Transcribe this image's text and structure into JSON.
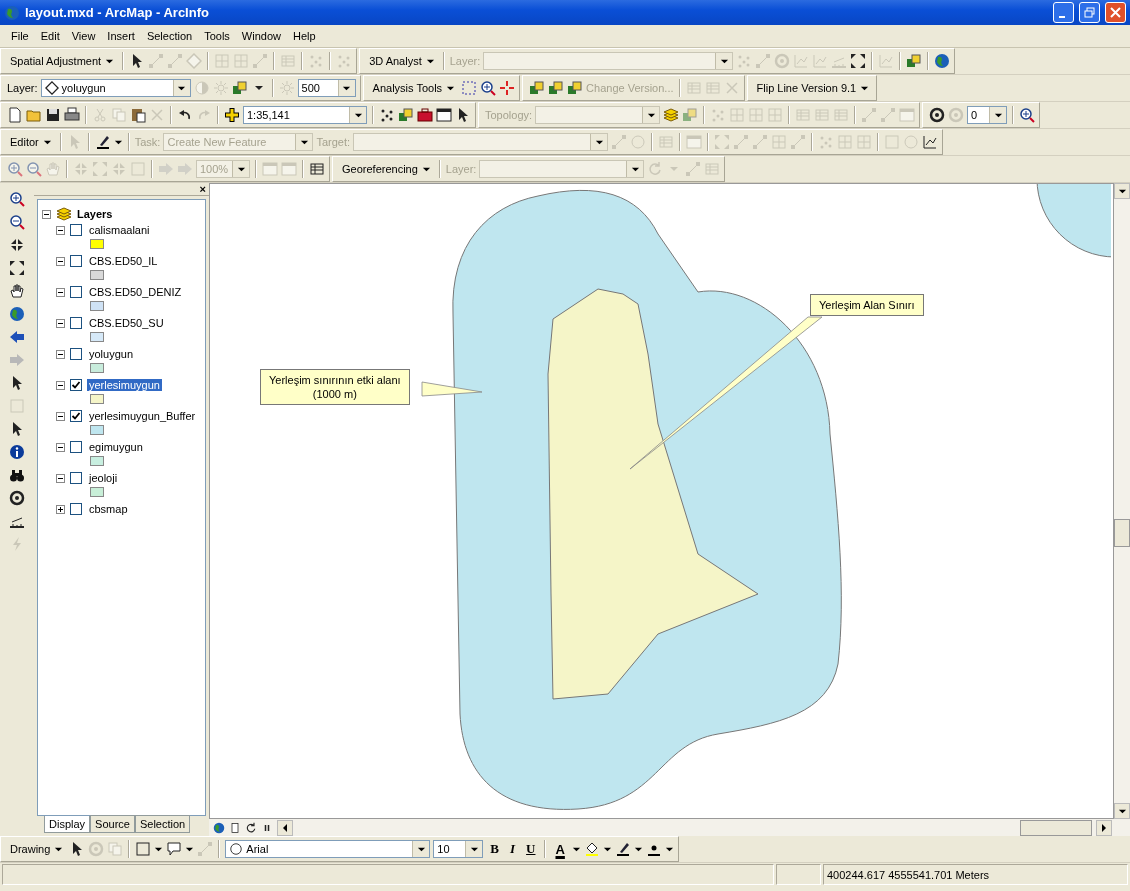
{
  "window": {
    "title": "layout.mxd - ArcMap - ArcInfo"
  },
  "menu": [
    "File",
    "Edit",
    "View",
    "Insert",
    "Selection",
    "Tools",
    "Window",
    "Help"
  ],
  "toolbars": {
    "spatial_adjustment": {
      "menu": "Spatial Adjustment"
    },
    "analyst_3d": {
      "menu": "3D Analyst",
      "layer_label": "Layer:",
      "disabled": true
    },
    "effects": {
      "layer_label": "Layer:",
      "layer": "yoluygun",
      "value": "500"
    },
    "analysis": {
      "menu": "Analysis Tools"
    },
    "versioning": {
      "change_version": "Change Version...",
      "disabled": true
    },
    "flip_line": {
      "menu": "Flip Line Version 9.1"
    },
    "standard": {
      "scale": "1:35,141"
    },
    "topology": {
      "label": "Topology:",
      "disabled": true
    },
    "snapping": {
      "value": "0"
    },
    "editor": {
      "menu": "Editor",
      "task_label": "Task:",
      "task": "Create New Feature",
      "target_label": "Target:",
      "disabled": true
    },
    "layout": {
      "zoom": "100%",
      "disabled": true
    },
    "georeferencing": {
      "menu": "Georeferencing",
      "layer_label": "Layer:",
      "disabled": true
    },
    "drawing": {
      "menu": "Drawing",
      "font": "Arial",
      "size": "10",
      "bold": "B",
      "italic": "I",
      "underline": "U",
      "font_color": "A"
    }
  },
  "toc": {
    "close": "×",
    "root": {
      "label": "Layers",
      "expanded": true
    },
    "layers": [
      {
        "name": "calismaalani",
        "checked": false,
        "expanded": true,
        "selected": false,
        "color": "#ffff00"
      },
      {
        "name": "CBS.ED50_IL",
        "checked": false,
        "expanded": true,
        "selected": false,
        "color": "#d9d9d9"
      },
      {
        "name": "CBS.ED50_DENIZ",
        "checked": false,
        "expanded": true,
        "selected": false,
        "color": "#cfe2f5"
      },
      {
        "name": "CBS.ED50_SU",
        "checked": false,
        "expanded": true,
        "selected": false,
        "color": "#d6e9f8"
      },
      {
        "name": "yoluygun",
        "checked": false,
        "expanded": true,
        "selected": false,
        "color": "#c8ecdc"
      },
      {
        "name": "yerlesimuygun",
        "checked": true,
        "expanded": true,
        "selected": true,
        "color": "#f5f5c8"
      },
      {
        "name": "yerlesimuygun_Buffer",
        "checked": true,
        "expanded": true,
        "selected": false,
        "color": "#bfe6ef"
      },
      {
        "name": "egimuygun",
        "checked": false,
        "expanded": true,
        "selected": false,
        "color": "#c8efe0"
      },
      {
        "name": "jeoloji",
        "checked": false,
        "expanded": true,
        "selected": false,
        "color": "#c8efd8"
      },
      {
        "name": "cbsmap",
        "checked": false,
        "expanded": false,
        "selected": false
      }
    ],
    "tabs": [
      {
        "label": "Display",
        "selected": true
      },
      {
        "label": "Source",
        "selected": false
      },
      {
        "label": "Selection",
        "selected": false
      }
    ]
  },
  "map": {
    "callouts": [
      {
        "lines": [
          "Yerleşim Alan Sınırı"
        ]
      },
      {
        "lines": [
          "Yerleşim sınırının etki alanı",
          "(1000 m)"
        ]
      }
    ]
  },
  "status_bar": {
    "coordinates": "400244.617 4555541.701 Meters"
  }
}
